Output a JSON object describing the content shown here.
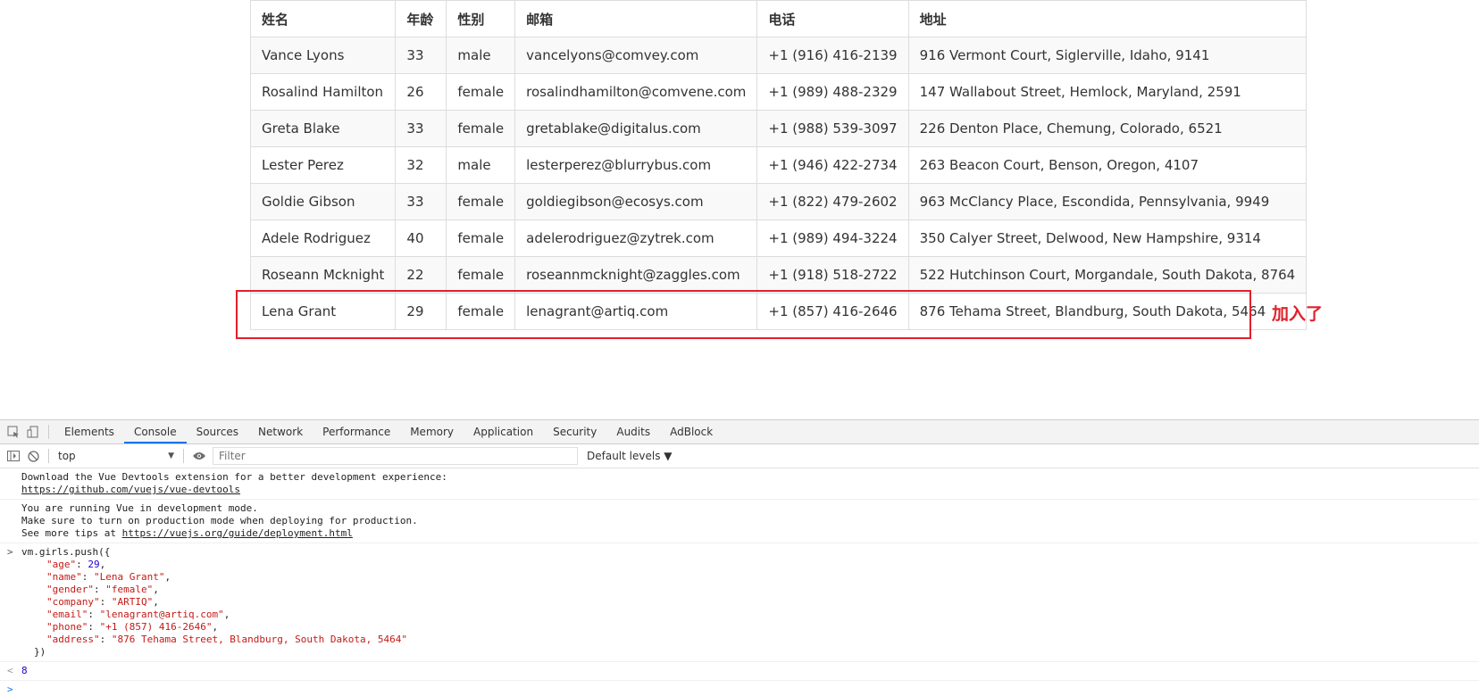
{
  "table": {
    "headers": [
      "姓名",
      "年龄",
      "性别",
      "邮箱",
      "电话",
      "地址"
    ],
    "rows": [
      [
        "Vance Lyons",
        "33",
        "male",
        "vancelyons@comvey.com",
        "+1 (916) 416-2139",
        "916 Vermont Court, Siglerville, Idaho, 9141"
      ],
      [
        "Rosalind Hamilton",
        "26",
        "female",
        "rosalindhamilton@comvene.com",
        "+1 (989) 488-2329",
        "147 Wallabout Street, Hemlock, Maryland, 2591"
      ],
      [
        "Greta Blake",
        "33",
        "female",
        "gretablake@digitalus.com",
        "+1 (988) 539-3097",
        "226 Denton Place, Chemung, Colorado, 6521"
      ],
      [
        "Lester Perez",
        "32",
        "male",
        "lesterperez@blurrybus.com",
        "+1 (946) 422-2734",
        "263 Beacon Court, Benson, Oregon, 4107"
      ],
      [
        "Goldie Gibson",
        "33",
        "female",
        "goldiegibson@ecosys.com",
        "+1 (822) 479-2602",
        "963 McClancy Place, Escondida, Pennsylvania, 9949"
      ],
      [
        "Adele Rodriguez",
        "40",
        "female",
        "adelerodriguez@zytrek.com",
        "+1 (989) 494-3224",
        "350 Calyer Street, Delwood, New Hampshire, 9314"
      ],
      [
        "Roseann Mcknight",
        "22",
        "female",
        "roseannmcknight@zaggles.com",
        "+1 (918) 518-2722",
        "522 Hutchinson Court, Morgandale, South Dakota, 8764"
      ],
      [
        "Lena Grant",
        "29",
        "female",
        "lenagrant@artiq.com",
        "+1 (857) 416-2646",
        "876 Tehama Street, Blandburg, South Dakota, 5464"
      ]
    ]
  },
  "annotation": {
    "text": "加入了",
    "color": "#e0212b"
  },
  "devtools": {
    "tabs": [
      "Elements",
      "Console",
      "Sources",
      "Network",
      "Performance",
      "Memory",
      "Application",
      "Security",
      "Audits",
      "AdBlock"
    ],
    "active_tab": "Console",
    "context": "top",
    "filter_placeholder": "Filter",
    "levels": "Default levels ▼",
    "accent": "#1a73e8"
  },
  "console": {
    "msg1_line1": "Download the Vue Devtools extension for a better development experience:",
    "msg1_link": "https://github.com/vuejs/vue-devtools",
    "msg2_line1": "You are running Vue in development mode.",
    "msg2_line2": "Make sure to turn on production mode when deploying for production.",
    "msg2_prefix": "See more tips at ",
    "msg2_link": "https://vuejs.org/guide/deployment.html",
    "cmd_open": "vm.girls.push({",
    "cmd_lines": [
      {
        "key": "\"age\"",
        "val": "29",
        "type": "num"
      },
      {
        "key": "\"name\"",
        "val": "\"Lena Grant\"",
        "type": "str"
      },
      {
        "key": "\"gender\"",
        "val": "\"female\"",
        "type": "str"
      },
      {
        "key": "\"company\"",
        "val": "\"ARTIQ\"",
        "type": "str"
      },
      {
        "key": "\"email\"",
        "val": "\"lenagrant@artiq.com\"",
        "type": "str"
      },
      {
        "key": "\"phone\"",
        "val": "\"+1 (857) 416-2646\"",
        "type": "str"
      },
      {
        "key": "\"address\"",
        "val": "\"876 Tehama Street, Blandburg, South Dakota, 5464\"",
        "type": "str"
      }
    ],
    "cmd_close": "})",
    "result": "8",
    "prompt_in": ">",
    "prompt_out": "<"
  }
}
